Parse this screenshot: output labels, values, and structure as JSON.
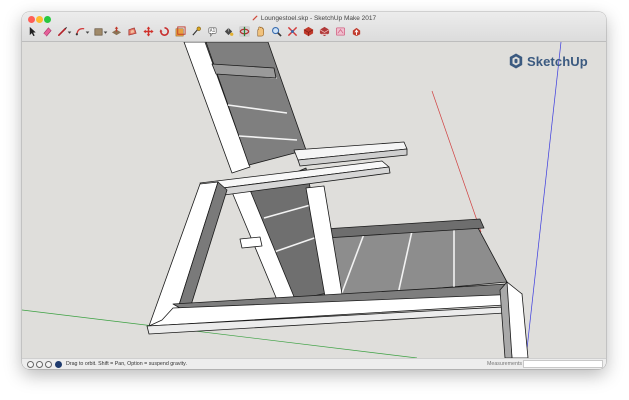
{
  "window": {
    "title": "Loungestoel.skp - SketchUp Make 2017"
  },
  "toolbar": {
    "tools": [
      {
        "name": "select-tool-icon",
        "color": "#333333"
      },
      {
        "name": "eraser-tool-icon",
        "color": "#e0508f"
      },
      {
        "name": "line-tool-icon",
        "color": "#b4232a"
      },
      {
        "name": "arc-tool-icon",
        "color": "#d23a3a"
      },
      {
        "name": "rectangle-tool-icon",
        "color": "#8a6e4d"
      },
      {
        "name": "push-pull-tool-icon",
        "color": "#c0392b"
      },
      {
        "name": "offset-tool-icon",
        "color": "#d8403a"
      },
      {
        "name": "move-tool-icon",
        "color": "#d0302a"
      },
      {
        "name": "rotate-tool-icon",
        "color": "#c82f2f"
      },
      {
        "name": "scale-tool-icon",
        "color": "#c0392b"
      },
      {
        "name": "tape-measure-tool-icon",
        "color": "#b8860b"
      },
      {
        "name": "text-tool-icon",
        "color": "#666666"
      },
      {
        "name": "paint-bucket-tool-icon",
        "color": "#c98b1e"
      },
      {
        "name": "orbit-tool-icon",
        "color": "#b23030"
      },
      {
        "name": "pan-tool-icon",
        "color": "#e0a060"
      },
      {
        "name": "zoom-tool-icon",
        "color": "#3a6db0"
      },
      {
        "name": "zoom-extents-tool-icon",
        "color": "#d33a3a"
      },
      {
        "name": "warehouse-tool-icon",
        "color": "#c0392b"
      },
      {
        "name": "extension-warehouse-tool-icon",
        "color": "#c0392b"
      },
      {
        "name": "layout-tool-icon",
        "color": "#d06080"
      },
      {
        "name": "share-model-tool-icon",
        "color": "#c0392b"
      }
    ]
  },
  "viewport": {
    "logo_text": "SketchUp",
    "logo_color": "#3b5a80",
    "axis_colors": {
      "red": "#d04040",
      "green": "#3aa040",
      "blue": "#3a3adf"
    }
  },
  "statusbar": {
    "hint": "Drag to orbit. Shift = Pan, Option = suspend gravity.",
    "measurements_label": "Measurements",
    "measurements_value": ""
  }
}
